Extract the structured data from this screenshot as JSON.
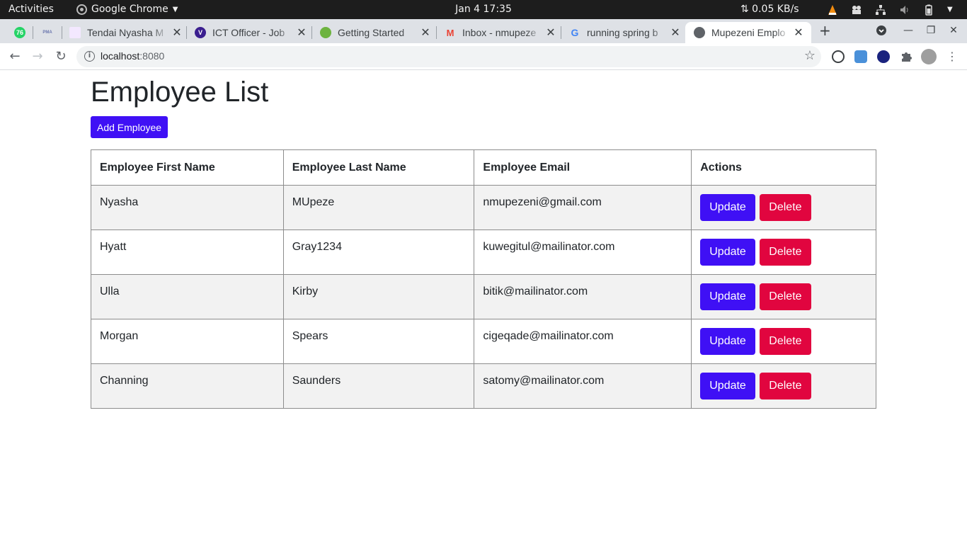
{
  "system_bar": {
    "activities": "Activities",
    "app_name": "Google Chrome",
    "clock": "Jan 4  17:35",
    "net_speed": "⇅ 0.05 KB/s"
  },
  "browser": {
    "tabs": [
      {
        "label": "",
        "icon": "whatsapp-icon",
        "badge": "76"
      },
      {
        "label": "",
        "icon": "pma-icon",
        "badge": "PMA"
      },
      {
        "label": "Tendai Nyasha M",
        "icon": "sheet-icon"
      },
      {
        "label": "ICT Officer - Job",
        "icon": "vivid-v-icon",
        "badge": "V"
      },
      {
        "label": "Getting Started",
        "icon": "spring-icon"
      },
      {
        "label": "Inbox - nmupeze",
        "icon": "gmail-icon",
        "badge": "M"
      },
      {
        "label": "running spring b",
        "icon": "google-icon",
        "badge": "G"
      },
      {
        "label": "Mupezeni Emplo",
        "icon": "globe-icon",
        "active": true
      }
    ],
    "url_host": "localhost",
    "url_port": ":8080"
  },
  "page": {
    "title": "Employee List",
    "add_button": "Add Employee",
    "columns": [
      "Employee First Name",
      "Employee Last Name",
      "Employee Email",
      "Actions"
    ],
    "update_label": "Update",
    "delete_label": "Delete",
    "rows": [
      {
        "first": "Nyasha",
        "last": "MUpeze",
        "email": "nmupezeni@gmail.com"
      },
      {
        "first": "Hyatt",
        "last": "Gray1234",
        "email": "kuwegitul@mailinator.com"
      },
      {
        "first": "Ulla",
        "last": "Kirby",
        "email": "bitik@mailinator.com"
      },
      {
        "first": "Morgan",
        "last": "Spears",
        "email": "cigeqade@mailinator.com"
      },
      {
        "first": "Channing",
        "last": "Saunders",
        "email": "satomy@mailinator.com"
      }
    ]
  },
  "colors": {
    "primary_button": "#3f10f5",
    "danger_button": "#e1053f"
  }
}
